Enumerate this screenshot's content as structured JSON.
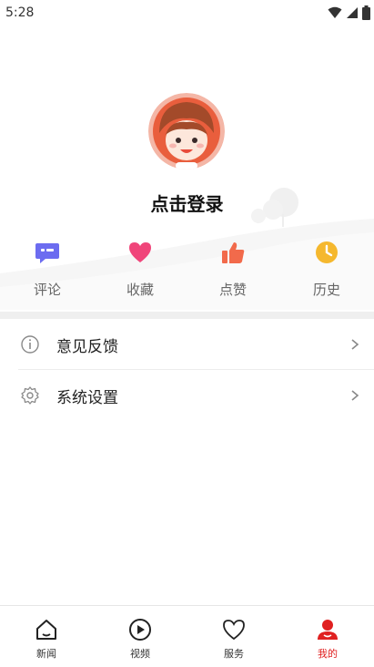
{
  "status_bar": {
    "time": "5:28"
  },
  "profile": {
    "login_prompt": "点击登录"
  },
  "quick_actions": [
    {
      "label": "评论",
      "icon": "comment-icon",
      "color": "#6c6cf0"
    },
    {
      "label": "收藏",
      "icon": "heart-icon",
      "color": "#f0457a"
    },
    {
      "label": "点赞",
      "icon": "thumbs-up-icon",
      "color": "#f26a4b"
    },
    {
      "label": "历史",
      "icon": "clock-icon",
      "color": "#f5b82e"
    }
  ],
  "menu": [
    {
      "label": "意见反馈",
      "icon": "info-icon"
    },
    {
      "label": "系统设置",
      "icon": "gear-icon"
    }
  ],
  "tabs": [
    {
      "label": "新闻",
      "icon": "home-icon",
      "active": false
    },
    {
      "label": "视频",
      "icon": "play-icon",
      "active": false
    },
    {
      "label": "服务",
      "icon": "heart-outline-icon",
      "active": false
    },
    {
      "label": "我的",
      "icon": "user-icon",
      "active": true
    }
  ],
  "colors": {
    "accent": "#e02020",
    "divider": "#efefef"
  }
}
